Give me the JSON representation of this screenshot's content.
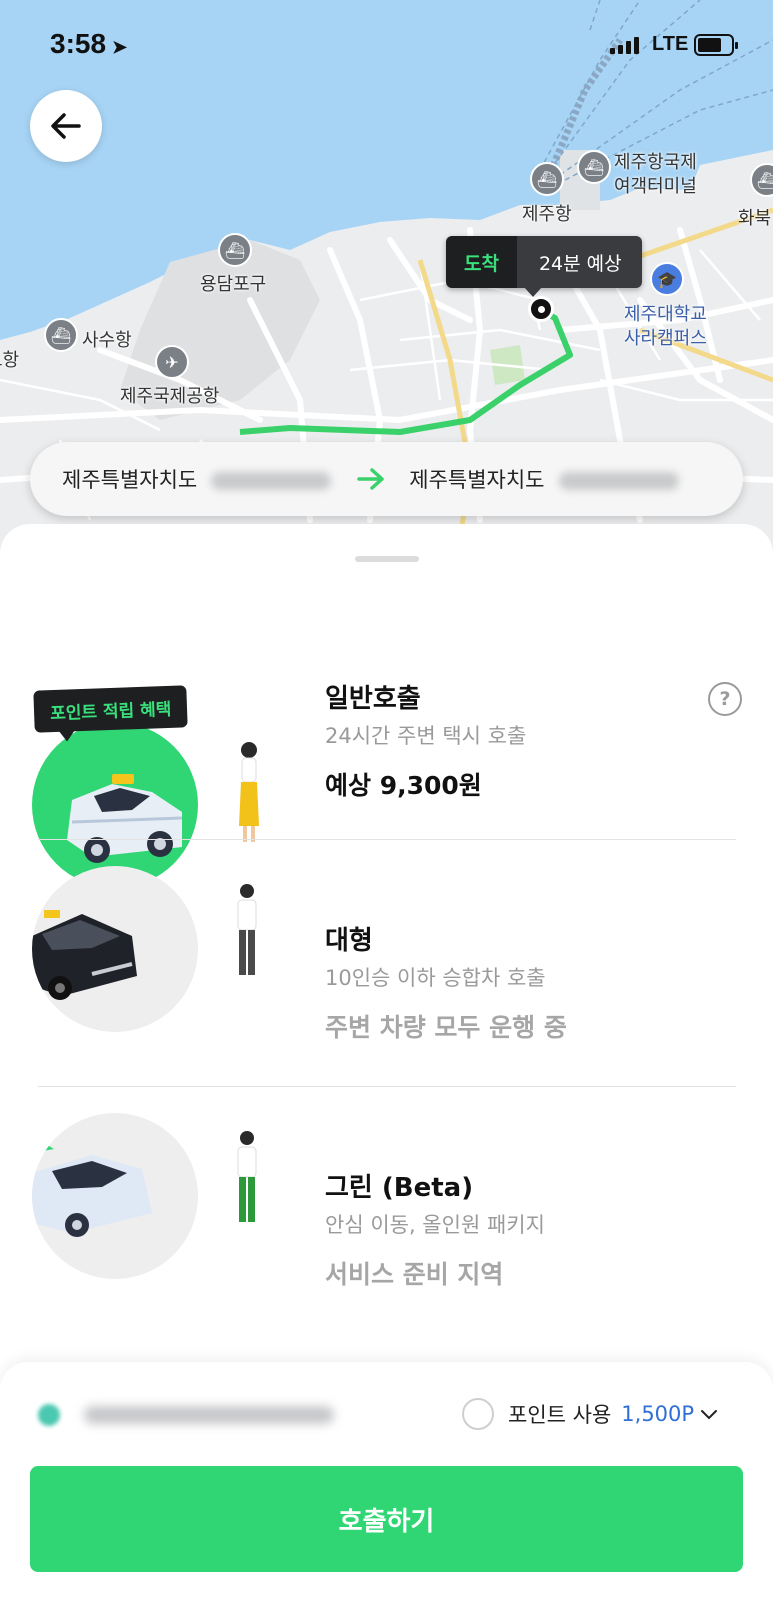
{
  "status_bar": {
    "time": "3:58",
    "network": "LTE"
  },
  "map": {
    "labels": {
      "port_terminal": [
        "제주항국제",
        "여객터미널"
      ],
      "jeju_port": "제주항",
      "hwabuk": "화북",
      "yongdampogu": "용담포구",
      "sasuhang": "사수항",
      "airport": "제주국제공항",
      "university": [
        "제주대학교",
        "사라캠퍼스"
      ],
      "edge": "도항"
    },
    "arrival": {
      "tag": "도착",
      "eta": "24분 예상"
    }
  },
  "route": {
    "origin": "제주특별자치도",
    "destination": "제주특별자치도"
  },
  "options": [
    {
      "title": "일반호출",
      "subtitle": "24시간 주변 택시 호출",
      "detail": "예상 9,300원",
      "badge": "포인트 적립 혜택"
    },
    {
      "title": "대형",
      "subtitle": "10인승 이하 승합차 호출",
      "detail": "주변 차량 모두 운행 중"
    },
    {
      "title": "그린 (Beta)",
      "subtitle": "안심 이동, 올인원 패키지",
      "detail": "서비스 준비 지역"
    }
  ],
  "help_label": "?",
  "payment": {
    "points_label": "포인트 사용",
    "points_value": "1,500P"
  },
  "call_button": "호출하기",
  "colors": {
    "accent": "#2fd673",
    "badge_text": "#39e07c",
    "link_blue": "#2f6fd6"
  }
}
